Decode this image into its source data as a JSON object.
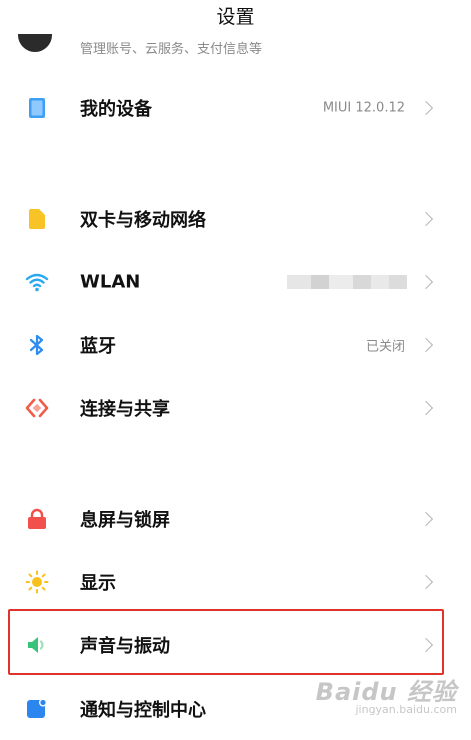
{
  "header": {
    "title": "设置"
  },
  "account": {
    "subtitle": "管理账号、云服务、支付信息等"
  },
  "rows": [
    {
      "id": "device",
      "label": "我的设备",
      "value": "MIUI 12.0.12",
      "icon": "tablet-icon",
      "icon_color": "#3e9ff5"
    },
    {
      "id": "sim",
      "label": "双卡与移动网络",
      "value": "",
      "icon": "sim-card-icon",
      "icon_color": "#f7c326"
    },
    {
      "id": "wlan",
      "label": "WLAN",
      "value": "",
      "icon": "wifi-icon",
      "icon_color": "#2aa8f0"
    },
    {
      "id": "bluetooth",
      "label": "蓝牙",
      "value": "已关闭",
      "icon": "bluetooth-icon",
      "icon_color": "#2c8cf1"
    },
    {
      "id": "connect",
      "label": "连接与共享",
      "value": "",
      "icon": "share-icon",
      "icon_color": "#f25c4a"
    },
    {
      "id": "lock",
      "label": "息屏与锁屏",
      "value": "",
      "icon": "lock-icon",
      "icon_color": "#f2504d"
    },
    {
      "id": "display",
      "label": "显示",
      "value": "",
      "icon": "sun-icon",
      "icon_color": "#f8c21a"
    },
    {
      "id": "sound",
      "label": "声音与振动",
      "value": "",
      "icon": "speaker-icon",
      "icon_color": "#37c47a"
    },
    {
      "id": "notify",
      "label": "通知与控制中心",
      "value": "",
      "icon": "notification-icon",
      "icon_color": "#2c86f0"
    }
  ],
  "watermark": {
    "main": "Baidu 经验",
    "sub": "jingyan.baidu.com"
  },
  "colors": {
    "highlight": "#e0332b",
    "chevron": "#b5b5b5",
    "secondary_text": "#8a8a8a"
  }
}
